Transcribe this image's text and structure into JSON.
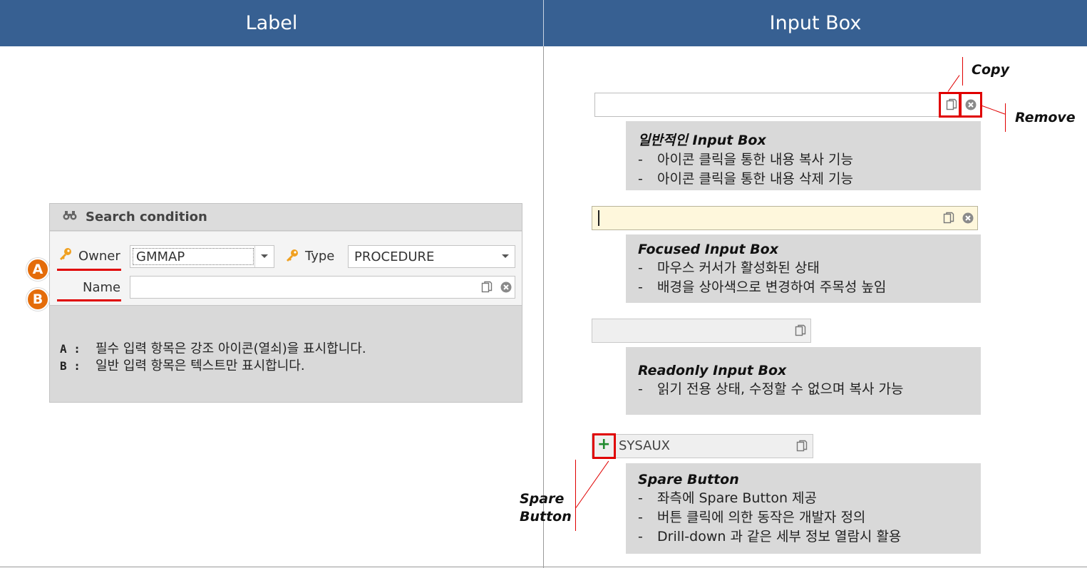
{
  "headers": {
    "left": "Label",
    "right": "Input Box"
  },
  "search_panel": {
    "title": "Search condition",
    "owner_label": "Owner",
    "owner_value": "GMMAP",
    "type_label": "Type",
    "type_value": "PROCEDURE",
    "name_label": "Name",
    "name_value": ""
  },
  "markers": {
    "a": "A",
    "b": "B"
  },
  "notes": [
    {
      "key": "A :",
      "text": "필수 입력 항목은 강조 아이콘(열쇠)을 표시합니다."
    },
    {
      "key": "B :",
      "text": "일반 입력 항목은 텍스트만 표시합니다."
    }
  ],
  "callouts": {
    "copy": "Copy",
    "remove": "Remove",
    "spare_line1": "Spare",
    "spare_line2": "Button"
  },
  "sections": [
    {
      "title": "일반적인 Input Box",
      "bullets": [
        "아이콘 클릭을 통한 내용 복사 기능",
        "아이콘 클릭을 통한 내용 삭제 기능"
      ]
    },
    {
      "title": "Focused Input Box",
      "bullets": [
        "마우스 커서가 활성화된 상태",
        "배경을 상아색으로 변경하여 주목성 높임"
      ]
    },
    {
      "title": "Readonly Input Box",
      "bullets": [
        "읽기 전용 상태, 수정할 수 없으며 복사 가능"
      ]
    },
    {
      "title": "Spare Button",
      "bullets": [
        "좌측에 Spare Button 제공",
        "버튼 클릭에 의한 동작은 개발자 정의",
        "Drill-down 과 같은 세부 정보 열람시 활용"
      ]
    }
  ],
  "spare_input_value": "SYSAUX",
  "icons": [
    "binoculars-icon",
    "key-icon",
    "copy-icon",
    "remove-icon",
    "plus-icon",
    "chevron-down-icon"
  ],
  "colors": {
    "header": "#376092",
    "accent_red": "#e00000",
    "marker_orange": "#e46c0a",
    "focus_bg": "#fef7dc",
    "panel_gray": "#d9d9d9"
  }
}
